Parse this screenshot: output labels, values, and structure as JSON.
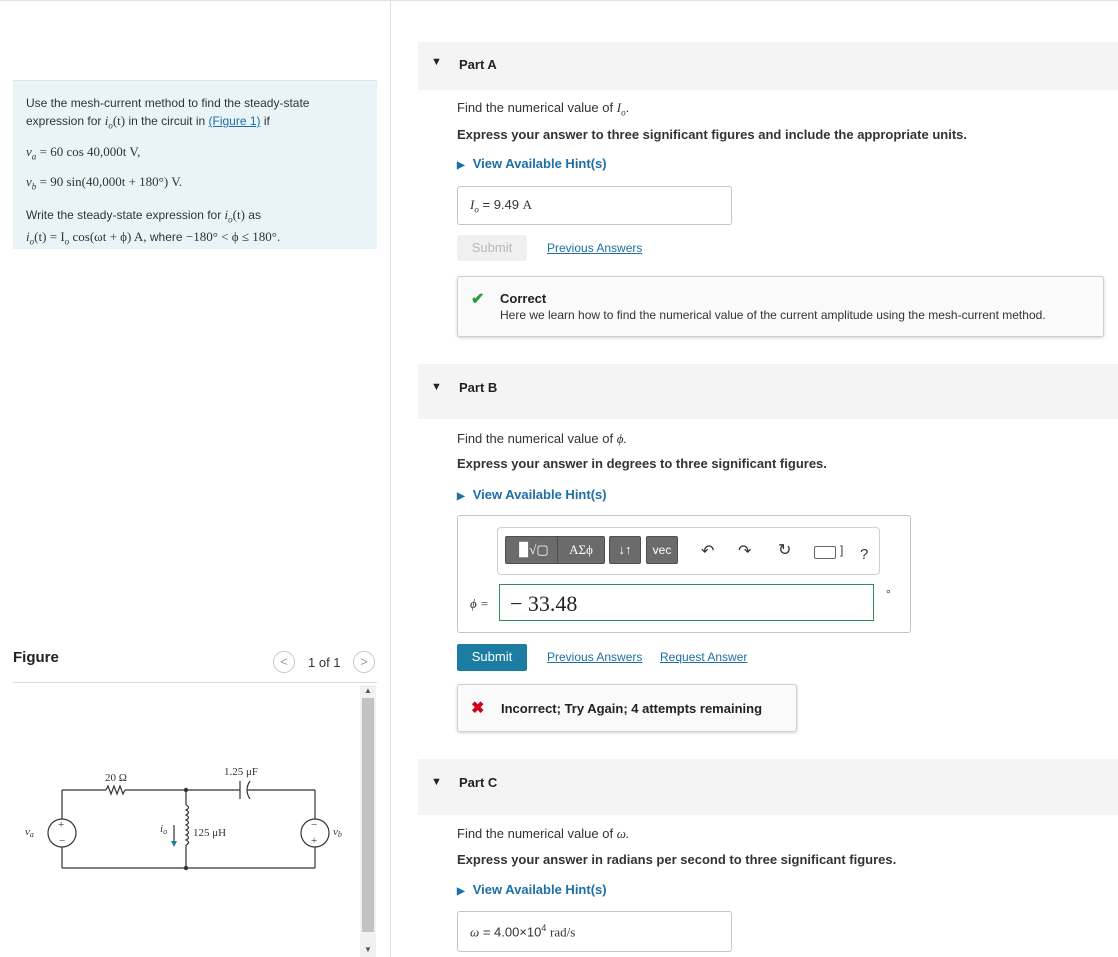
{
  "problem": {
    "intro": "Use the mesh-current method to find the steady-state expression for",
    "io_sym": "i",
    "io_sub": "o",
    "t_arg": "(t)",
    "in_circuit": "in the circuit in",
    "figure_link": "(Figure 1)",
    "if_word": "if",
    "va_eq": "= 60 cos 40,000t V,",
    "vb_eq": "= 90 sin(40,000t + 180°) V.",
    "write_line": "Write the steady-state expression for",
    "as_word": "as",
    "io_expr": "= I",
    "io_expr_rest": "cos(ωt + ϕ) A,",
    "where_word": "where",
    "range": "−180° < ϕ ≤ 180°."
  },
  "figure": {
    "title": "Figure",
    "pager_text": "1 of 1",
    "prev_icon": "chevron-left-icon",
    "next_icon": "chevron-right-icon",
    "circuit": {
      "resistor": "20 Ω",
      "capacitor": "1.25 μF",
      "inductor": "125 μH",
      "io_label": "i",
      "io_sub": "o",
      "va_label": "v",
      "va_sub": "a",
      "vb_label": "v",
      "vb_sub": "b",
      "plus": "+",
      "minus": "−"
    }
  },
  "partA": {
    "label": "Part A",
    "find_text": "Find the numerical value of",
    "find_sym": "I",
    "find_sub": "o",
    "instruction": "Express your answer to three significant figures and include the appropriate units.",
    "hint": "View Available Hint(s)",
    "answer_sym": "I",
    "answer_sub": "o",
    "answer_eq": "=",
    "answer_value": "9.49",
    "answer_unit": "A",
    "submit": "Submit",
    "previous_answers": "Previous Answers",
    "feedback_title": "Correct",
    "feedback_text": "Here we learn how to find the numerical value of the current amplitude using the mesh-current method."
  },
  "partB": {
    "label": "Part B",
    "find_text": "Find the numerical value of",
    "find_sym": "ϕ.",
    "instruction": "Express your answer in degrees to three significant figures.",
    "hint": "View Available Hint(s)",
    "toolbar": {
      "templates": "▉√▢",
      "greek": "ΑΣϕ",
      "arrows": "↓↑",
      "vec": "vec",
      "help": "?"
    },
    "input_label": "ϕ =",
    "input_value": "− 33.48",
    "unit": "°",
    "submit": "Submit",
    "previous_answers": "Previous Answers",
    "request_answer": "Request Answer",
    "feedback_text": "Incorrect; Try Again; 4 attempts remaining"
  },
  "partC": {
    "label": "Part C",
    "find_text": "Find the numerical value of",
    "find_sym": "ω.",
    "instruction": "Express your answer in radians per second to three significant figures.",
    "hint": "View Available Hint(s)",
    "answer_sym": "ω",
    "answer_eq": "=",
    "answer_mantissa": "4.00×10",
    "answer_exp": "4",
    "answer_unit": "rad/s"
  },
  "colors": {
    "accent": "#1c7ca2",
    "link": "#1d6fa5",
    "correct": "#2e9a3c",
    "incorrect": "#d0021b",
    "panel": "#eaf4f6"
  }
}
